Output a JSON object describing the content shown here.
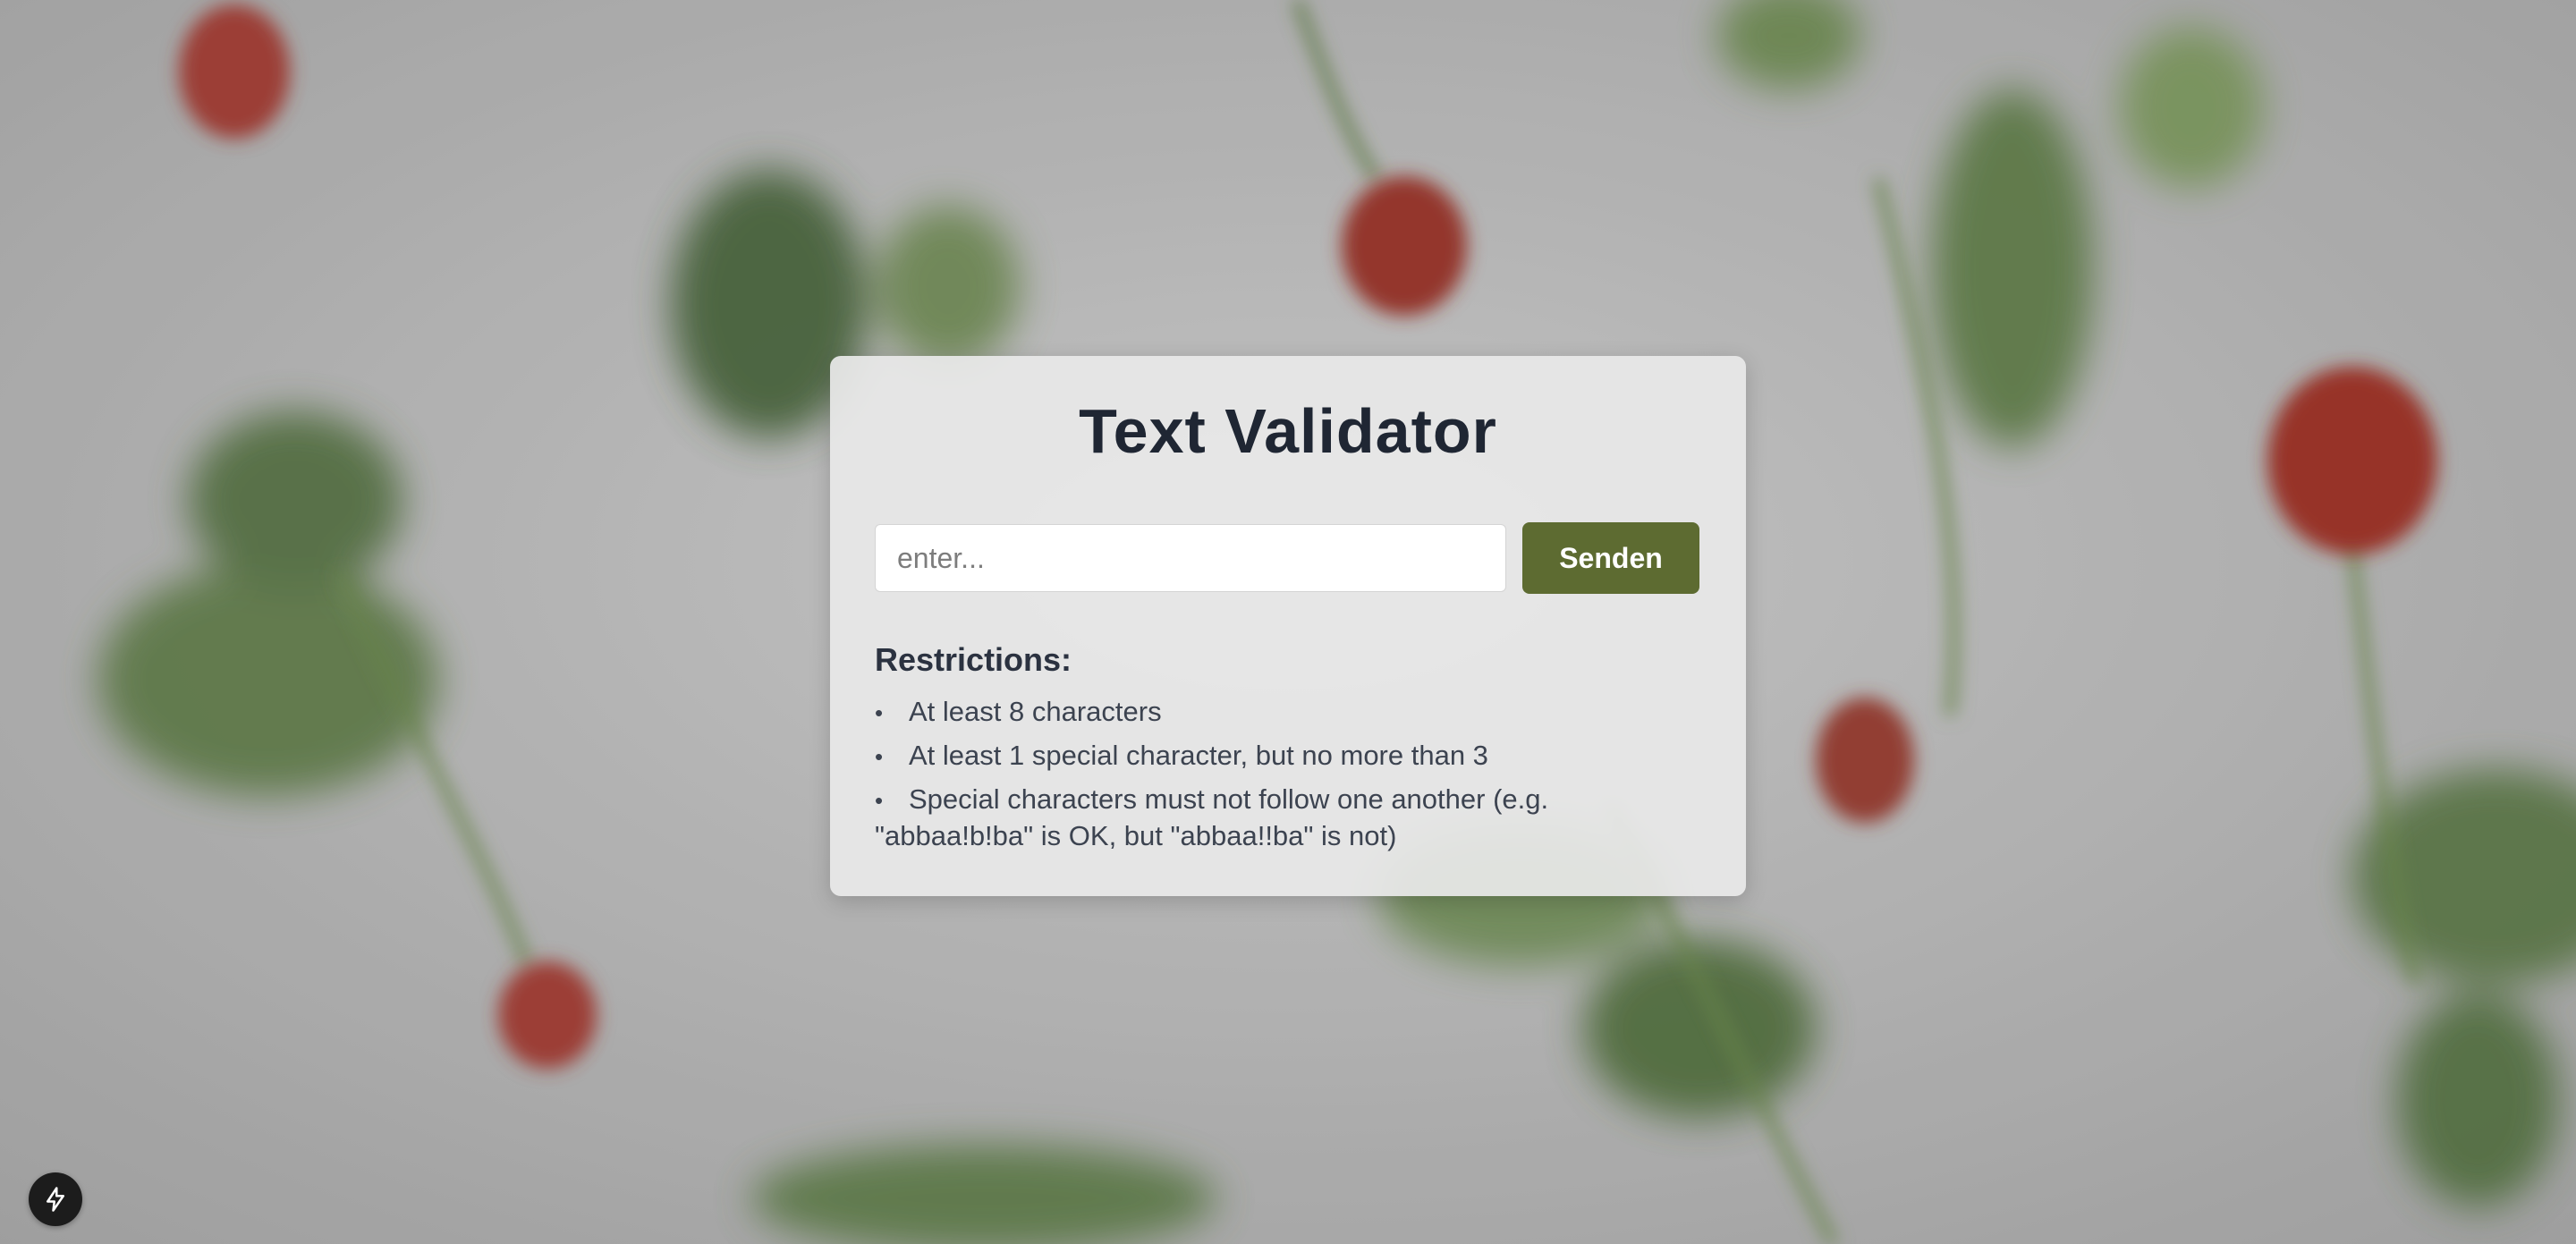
{
  "validator": {
    "title": "Text Validator",
    "input_placeholder": "enter...",
    "input_value": "",
    "send_label": "Senden",
    "restrictions_heading": "Restrictions:",
    "restrictions": [
      "At least 8 characters",
      "At least 1 special character, but no more than 3",
      "Special characters must not follow one another (e.g. \"abbaa!b!ba\" is OK, but \"abbaa!!ba\" is not)"
    ]
  },
  "colors": {
    "button_bg": "#5d6b31",
    "title_text": "#1f2633",
    "card_bg": "#e8e8e8"
  },
  "icons": {
    "corner_button": "lightning-bolt-icon"
  }
}
